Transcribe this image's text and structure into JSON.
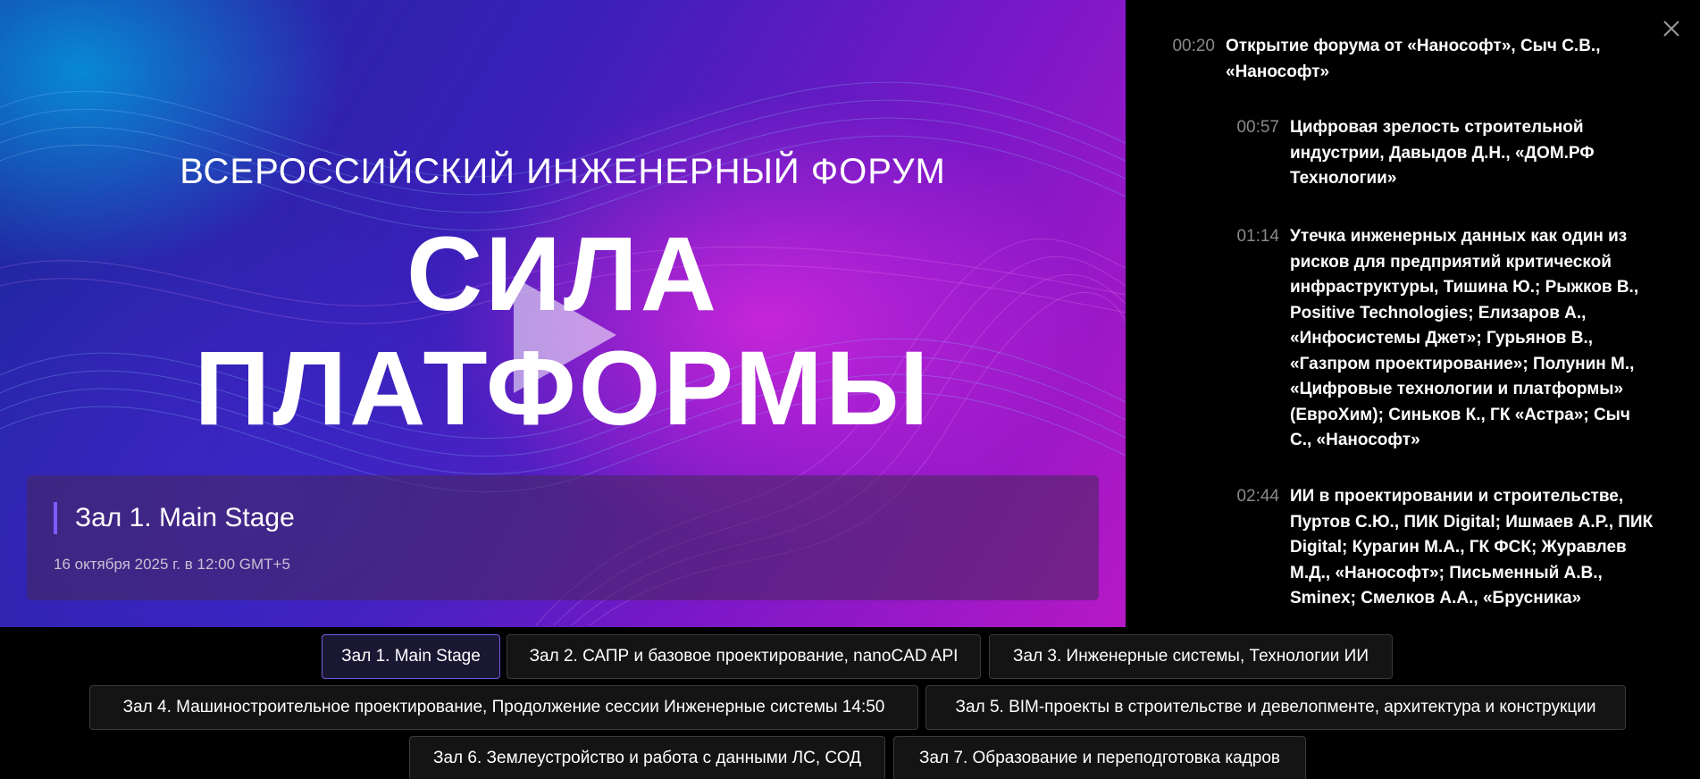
{
  "video": {
    "banner_subtitle": "ВСЕРОССИЙСКИЙ ИНЖЕНЕРНЫЙ ФОРУМ",
    "banner_title_line1": "СИЛА",
    "banner_title_line2": "ПЛАТФОРМЫ",
    "session_title": "Зал 1. Main Stage",
    "session_date": "16 октября 2025 г. в 12:00 GMT+5"
  },
  "agenda": {
    "items": [
      {
        "time": "00:20",
        "title": "Открытие форума от «Нанософт», Сыч С.В., «Нанософт»"
      },
      {
        "time": "00:57",
        "title": "Цифровая зрелость строительной индустрии, Давыдов Д.Н., «ДОМ.РФ Технологии»"
      },
      {
        "time": "01:14",
        "title": "Утечка инженерных данных как один из рисков для предприятий критической инфраструктуры, Тишина Ю.; Рыжков В., Positive Technologies; Елизаров А., «Инфосистемы Джет»; Гурьянов В., «Газпром проектирование»; Полунин М., «Цифровые технологии и платформы» (ЕвроХим); Синьков К., ГК «Астра»; Сыч С., «Нанософт»"
      },
      {
        "time": "02:44",
        "title": "ИИ в проектировании и строительстве, Пуртов С.Ю., ПИК Digital; Ишмаев А.Р., ПИК Digital; Курагин М.А., ГК ФСК; Журавлев М.Д., «Нанософт»; Письменный А.В., Sminex; Смелков А.А., «Брусника»"
      }
    ]
  },
  "tabs": [
    {
      "label": "Зал 1. Main Stage"
    },
    {
      "label": "Зал 2. САПР и базовое проектирование, nanoCAD API"
    },
    {
      "label": "Зал 3. Инженерные системы, Технологии ИИ"
    },
    {
      "label": "Зал 4. Машиностроительное проектирование, Продолжение сессии Инженерные системы 14:50"
    },
    {
      "label": "Зал 5. BIM-проекты в строительстве и девелопменте, архитектура и конструкции"
    },
    {
      "label": "Зал 6. Землеустройство и работа с данными ЛС, СОД"
    },
    {
      "label": "Зал 7. Образование и переподготовка кадров"
    }
  ],
  "colors": {
    "accent": "#7c5cff",
    "active_tab_border": "#6f5fe0"
  }
}
